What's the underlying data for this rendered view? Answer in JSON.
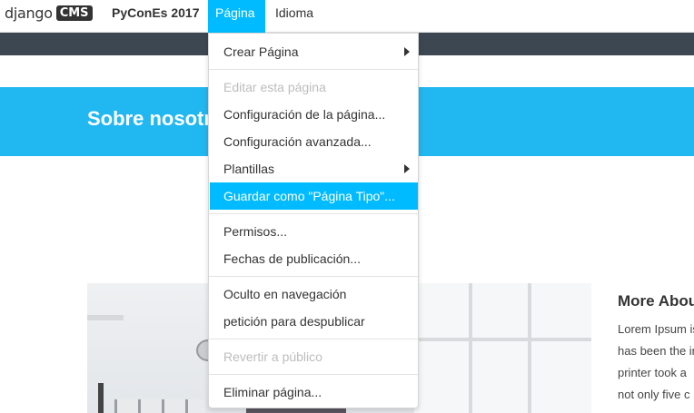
{
  "toolbar": {
    "logo_text": "django",
    "logo_badge": "CMS",
    "site_name": "PyConEs 2017",
    "menu_pagina": "Página",
    "menu_idioma": "Idioma",
    "accent_color": "#00bbff"
  },
  "hero": {
    "title": "Sobre nosotros"
  },
  "sidebar": {
    "title": "More About",
    "lines": [
      "Lorem Ipsum is",
      "has been the in",
      "printer took a",
      "not only five c"
    ]
  },
  "page_menu": {
    "items": [
      {
        "label": "Crear Página",
        "state": "enabled",
        "submenu": true
      },
      {
        "label": "Editar esta página",
        "state": "disabled",
        "submenu": false
      },
      {
        "label": "Configuración de la página...",
        "state": "enabled",
        "submenu": false
      },
      {
        "label": "Configuración avanzada...",
        "state": "enabled",
        "submenu": false
      },
      {
        "label": "Plantillas",
        "state": "enabled",
        "submenu": true
      },
      {
        "label": "Guardar como \"Página Tipo\"...",
        "state": "highlighted",
        "submenu": false
      },
      {
        "label": "Permisos...",
        "state": "enabled",
        "submenu": false
      },
      {
        "label": "Fechas de publicación...",
        "state": "enabled",
        "submenu": false
      },
      {
        "label": "Oculto en navegación",
        "state": "enabled",
        "submenu": false
      },
      {
        "label": "petición para despublicar",
        "state": "enabled",
        "submenu": false
      },
      {
        "label": "Revertir a público",
        "state": "disabled",
        "submenu": false
      },
      {
        "label": "Eliminar página...",
        "state": "enabled",
        "submenu": false
      }
    ]
  }
}
